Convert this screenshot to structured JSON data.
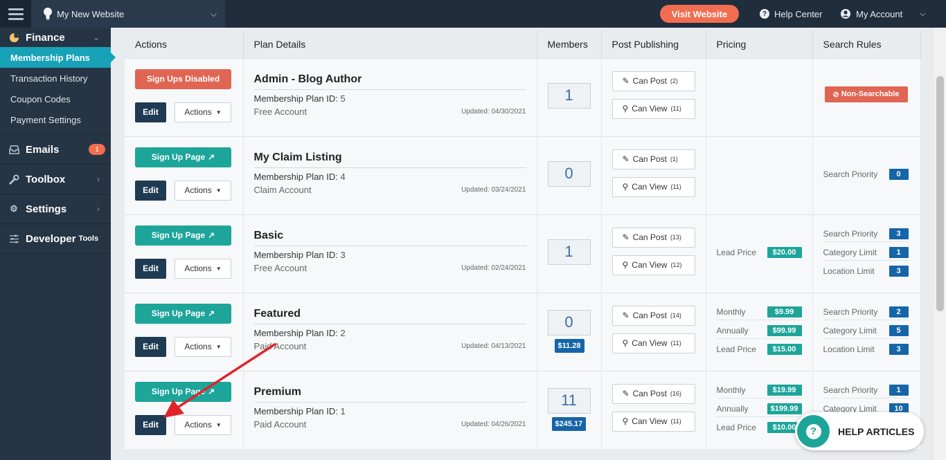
{
  "header": {
    "site_name": "My New Website",
    "visit_label": "Visit Website",
    "help_center": "Help Center",
    "my_account": "My Account"
  },
  "sidebar": {
    "finance": "Finance",
    "sub_items": [
      "Membership Plans",
      "Transaction History",
      "Coupon Codes",
      "Payment Settings"
    ],
    "emails": "Emails",
    "emails_badge": "1",
    "toolbox": "Toolbox",
    "settings": "Settings",
    "developer": "Developer",
    "developer_suffix": "Tools"
  },
  "table": {
    "columns": [
      "Actions",
      "Plan Details",
      "Members",
      "Post Publishing",
      "Pricing",
      "Search Rules"
    ],
    "common": {
      "edit": "Edit",
      "actions": "Actions",
      "signup_page": "Sign Up Page",
      "signups_disabled": "Sign Ups Disabled",
      "plan_id_label": "Membership Plan ID:",
      "can_post": "Can Post",
      "can_view": "Can View",
      "non_searchable": "Non-Searchable"
    },
    "rows": [
      {
        "name": "Admin - Blog Author",
        "id": "5",
        "type": "Free Account",
        "updated": "Updated: 04/30/2021",
        "members": "1",
        "member_price": "",
        "can_post": "(2)",
        "can_view": "(11)",
        "pricing": [],
        "rules": []
      },
      {
        "name": "My Claim Listing",
        "id": "4",
        "type": "Claim Account",
        "updated": "Updated: 03/24/2021",
        "members": "0",
        "member_price": "",
        "can_post": "(1)",
        "can_view": "(11)",
        "pricing": [],
        "rules": [
          {
            "label": "Search Priority",
            "value": "0"
          }
        ]
      },
      {
        "name": "Basic",
        "id": "3",
        "type": "Free Account",
        "updated": "Updated: 02/24/2021",
        "members": "1",
        "member_price": "",
        "can_post": "(13)",
        "can_view": "(12)",
        "pricing": [
          {
            "label": "Lead Price",
            "value": "$20.00"
          }
        ],
        "rules": [
          {
            "label": "Search Priority",
            "value": "3"
          },
          {
            "label": "Category Limit",
            "value": "1"
          },
          {
            "label": "Location Limit",
            "value": "3"
          }
        ]
      },
      {
        "name": "Featured",
        "id": "2",
        "type": "Paid Account",
        "updated": "Updated: 04/13/2021",
        "members": "0",
        "member_price": "$11.28",
        "can_post": "(14)",
        "can_view": "(11)",
        "pricing": [
          {
            "label": "Monthly",
            "value": "$9.99"
          },
          {
            "label": "Annually",
            "value": "$99.99"
          },
          {
            "label": "Lead Price",
            "value": "$15.00"
          }
        ],
        "rules": [
          {
            "label": "Search Priority",
            "value": "2"
          },
          {
            "label": "Category Limit",
            "value": "5"
          },
          {
            "label": "Location Limit",
            "value": "3"
          }
        ]
      },
      {
        "name": "Premium",
        "id": "1",
        "type": "Paid Account",
        "updated": "Updated: 04/26/2021",
        "members": "11",
        "member_price": "$245.17",
        "can_post": "(16)",
        "can_view": "(11)",
        "pricing": [
          {
            "label": "Monthly",
            "value": "$19.99"
          },
          {
            "label": "Annually",
            "value": "$199.99"
          },
          {
            "label": "Lead Price",
            "value": "$10.00"
          }
        ],
        "rules": [
          {
            "label": "Search Priority",
            "value": "1"
          },
          {
            "label": "Category Limit",
            "value": "10"
          }
        ]
      }
    ]
  },
  "help_widget": {
    "label": "HELP ARTICLES"
  },
  "colors": {
    "topbar": "#1f2d3d",
    "sidebar": "#263545",
    "active_nav": "#17a2b8",
    "teal": "#1da59a",
    "coral": "#e06552",
    "edit_navy": "#1f3a53",
    "blue_badge": "#1565a8",
    "annotation_arrow": "#e0242a"
  }
}
